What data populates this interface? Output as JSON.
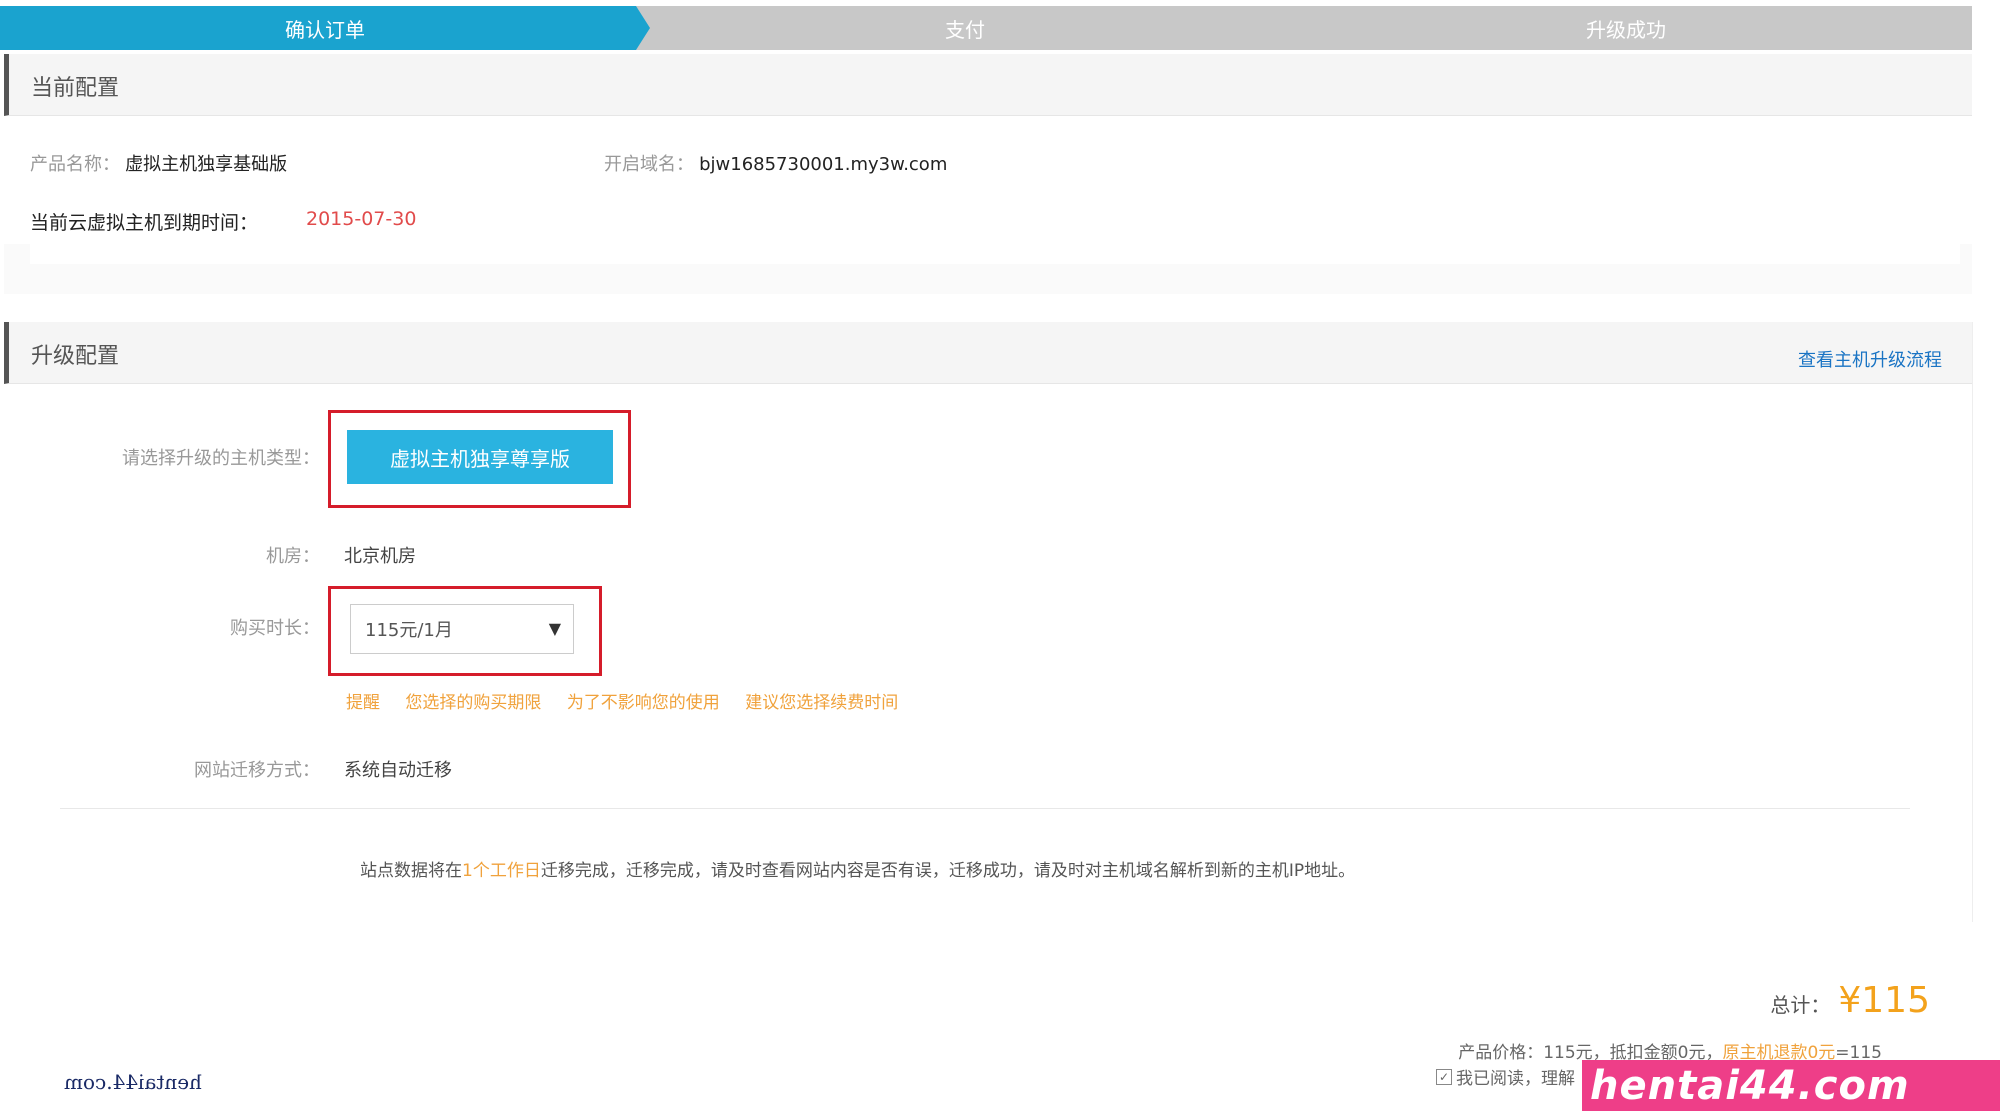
{
  "steps": [
    "确认订单",
    "支付",
    "升级成功"
  ],
  "current_config": {
    "title": "当前配置",
    "product_name_label": "产品名称：",
    "product_name": "虚拟主机独享基础版",
    "domain_label": "开启域名：",
    "domain": "bjw1685730001.my3w.com",
    "expiry_label": "当前云虚拟主机到期时间：",
    "expiry_date": "2015-07-30"
  },
  "upgrade_config": {
    "title": "升级配置",
    "process_link": "查看主机升级流程",
    "host_type_label": "请选择升级的主机类型：",
    "host_type_button": "虚拟主机独享尊享版",
    "room_label": "机房：",
    "room_value": "北京机房",
    "duration_label": "购买时长：",
    "duration_value": "115元/1月",
    "tip": [
      "提醒",
      "您选择的购买期限",
      "为了不影响您的使用",
      "建议您选择续费时间"
    ],
    "migration_label": "网站迁移方式：",
    "migration_value": "系统自动迁移",
    "note_before": "站点数据将在",
    "note_highlight": "1个工作日",
    "note_after": "迁移完成，迁移完成，请及时查看网站内容是否有误，迁移成功，请及时对主机域名解析到新的主机IP地址。"
  },
  "summary": {
    "total_label": "总计：",
    "total_amount": "¥115",
    "price_line_before": "产品价格：115元，抵扣金额0元，",
    "price_line_highlight": "原主机退款0元",
    "price_line_after": "=115",
    "agree_text": "我已阅读，理解"
  },
  "watermarks": {
    "left": "hentai44.com",
    "right": "hentai44.com"
  },
  "colors": {
    "active_step": "#1aa3cf",
    "inactive_step": "#c8c8c8",
    "accent_button": "#2ab3e0",
    "highlight_box": "#d51c2a",
    "warning_text": "#f0a23c",
    "date_red": "#e14b4b",
    "link_blue": "#1a74c4"
  }
}
